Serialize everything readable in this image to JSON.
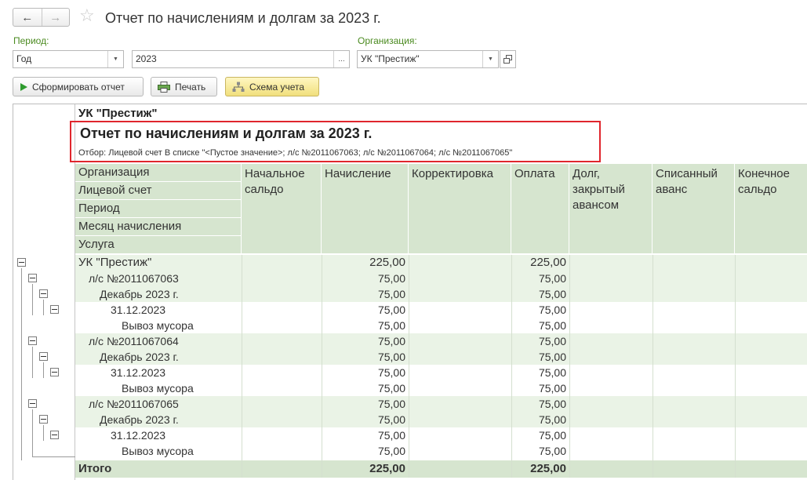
{
  "window": {
    "title": "Отчет по начислениям и долгам за 2023 г."
  },
  "form": {
    "period_label": "Период:",
    "period_type": "Год",
    "period_value": "2023",
    "period_value_btn": "...",
    "org_label": "Организация:",
    "org_value": "УК \"Престиж\""
  },
  "toolbar": {
    "generate_label": "Сформировать отчет",
    "print_label": "Печать",
    "scheme_label": "Схема учета"
  },
  "report": {
    "org_heading": "УК \"Престиж\"",
    "title": "Отчет по начислениям и долгам за 2023 г.",
    "filter": "Отбор: Лицевой счет В списке \"<Пустое значение>; л/с №2011067063; л/с №2011067064; л/с №2011067065\"",
    "group_headers": [
      "Организация",
      "Лицевой счет",
      "Период",
      "Месяц начисления",
      "Услуга"
    ],
    "columns": [
      "Начальное сальдо",
      "Начисление",
      "Корректировка",
      "Оплата",
      "Долг, закрытый авансом",
      "Списанный аванс",
      "Конечное сальдо"
    ],
    "rows": [
      {
        "label": "УК \"Престиж\"",
        "accrual": "225,00",
        "payment": "225,00"
      },
      {
        "label": "л/с №2011067063",
        "accrual": "75,00",
        "payment": "75,00"
      },
      {
        "label": "Декабрь 2023  г.",
        "accrual": "75,00",
        "payment": "75,00"
      },
      {
        "label": "31.12.2023",
        "accrual": "75,00",
        "payment": "75,00"
      },
      {
        "label": "Вывоз мусора",
        "accrual": "75,00",
        "payment": "75,00"
      },
      {
        "label": "л/с №2011067064",
        "accrual": "75,00",
        "payment": "75,00"
      },
      {
        "label": "Декабрь 2023  г.",
        "accrual": "75,00",
        "payment": "75,00"
      },
      {
        "label": "31.12.2023",
        "accrual": "75,00",
        "payment": "75,00"
      },
      {
        "label": "Вывоз мусора",
        "accrual": "75,00",
        "payment": "75,00"
      },
      {
        "label": "л/с №2011067065",
        "accrual": "75,00",
        "payment": "75,00"
      },
      {
        "label": "Декабрь 2023  г.",
        "accrual": "75,00",
        "payment": "75,00"
      },
      {
        "label": "31.12.2023",
        "accrual": "75,00",
        "payment": "75,00"
      },
      {
        "label": "Вывоз мусора",
        "accrual": "75,00",
        "payment": "75,00"
      }
    ],
    "total": {
      "label": "Итого",
      "accrual": "225,00",
      "payment": "225,00"
    }
  }
}
